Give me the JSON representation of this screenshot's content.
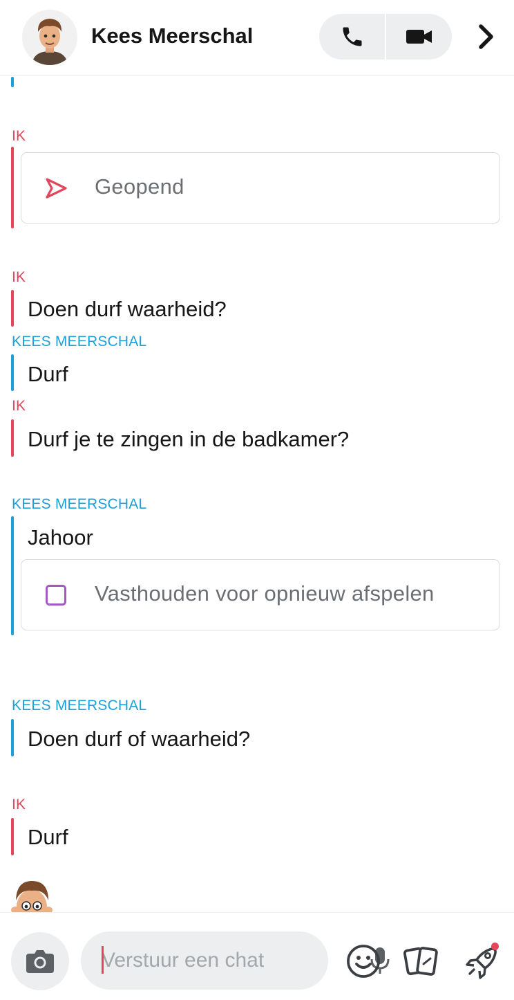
{
  "header": {
    "contact_name": "Kees Meerschal",
    "voice_call_icon": "phone-icon",
    "video_call_icon": "video-camera-icon",
    "more_icon": "chevron-right-icon"
  },
  "chat": {
    "messages": [
      {
        "sender": "IK",
        "type": "status",
        "text": "Geopend",
        "icon": "sent-arrow-icon"
      },
      {
        "sender": "IK",
        "type": "text",
        "text": "Doen durf waarheid?"
      },
      {
        "sender": "KEES MEERSCHAL",
        "type": "text",
        "text": "Durf"
      },
      {
        "sender": "IK",
        "type": "text",
        "text": "Durf je te zingen in de badkamer?"
      },
      {
        "sender": "KEES MEERSCHAL",
        "type": "text",
        "text": "Jahoor"
      },
      {
        "sender": "KEES MEERSCHAL",
        "type": "status",
        "text": "Vasthouden voor opnieuw afspelen",
        "icon": "replay-square-icon"
      },
      {
        "sender": "KEES MEERSCHAL",
        "type": "text",
        "text": "Doen durf of waarheid?"
      },
      {
        "sender": "IK",
        "type": "text",
        "text": "Durf"
      }
    ]
  },
  "composer": {
    "placeholder": "Verstuur een chat",
    "camera_icon": "camera-icon",
    "mic_icon": "microphone-icon",
    "emoji_icon": "smiley-icon",
    "stickers_icon": "cards-icon",
    "games_icon": "rocket-icon"
  },
  "colors": {
    "me": "#e2455c",
    "them": "#1d9fd8",
    "replay_icon": "#a35bc4"
  }
}
